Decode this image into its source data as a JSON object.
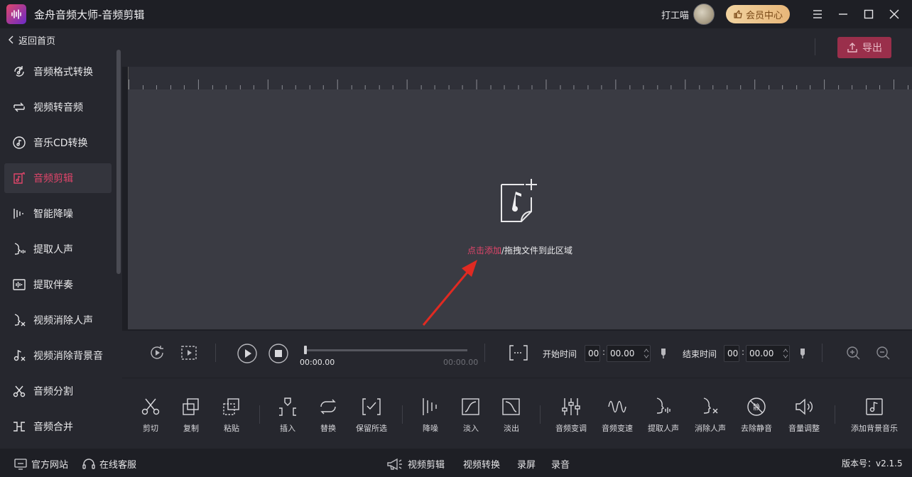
{
  "app": {
    "title": "金舟音频大师-音频剪辑",
    "username": "打工喵",
    "vip_label": "会员中心"
  },
  "sidebar": {
    "back_label": "返回首页",
    "items": [
      {
        "label": "音频格式转换",
        "icon": "audio-convert-icon"
      },
      {
        "label": "视频转音频",
        "icon": "video-to-audio-icon"
      },
      {
        "label": "音乐CD转换",
        "icon": "cd-icon"
      },
      {
        "label": "音频剪辑",
        "icon": "audio-edit-icon",
        "active": true
      },
      {
        "label": "智能降噪",
        "icon": "denoise-icon"
      },
      {
        "label": "提取人声",
        "icon": "extract-voice-icon"
      },
      {
        "label": "提取伴奏",
        "icon": "extract-accompaniment-icon"
      },
      {
        "label": "视频消除人声",
        "icon": "remove-voice-icon"
      },
      {
        "label": "视频消除背景音",
        "icon": "remove-bgm-icon"
      },
      {
        "label": "音频分割",
        "icon": "split-icon"
      },
      {
        "label": "音频合并",
        "icon": "merge-icon"
      }
    ]
  },
  "toolbar": {
    "export_label": "导出"
  },
  "dropzone": {
    "add_link": "点击添加",
    "hint": "/拖拽文件到此区域"
  },
  "transport": {
    "current_time": "00:00.00",
    "total_time": "00:00.00",
    "start_label": "开始时间",
    "end_label": "结束时间",
    "start_min": "00",
    "start_sec": "00.00",
    "end_min": "00",
    "end_sec": "00.00",
    "colon": ":"
  },
  "tools": [
    {
      "label": "剪切",
      "icon": "scissors-icon"
    },
    {
      "label": "复制",
      "icon": "copy-icon"
    },
    {
      "label": "粘贴",
      "icon": "paste-icon"
    },
    {
      "label": "插入",
      "icon": "insert-icon"
    },
    {
      "label": "替换",
      "icon": "replace-icon"
    },
    {
      "label": "保留所选",
      "icon": "keep-selection-icon"
    },
    {
      "label": "降噪",
      "icon": "denoise-icon"
    },
    {
      "label": "淡入",
      "icon": "fade-in-icon"
    },
    {
      "label": "淡出",
      "icon": "fade-out-icon"
    },
    {
      "label": "音频变调",
      "icon": "pitch-icon"
    },
    {
      "label": "音频变速",
      "icon": "speed-icon"
    },
    {
      "label": "提取人声",
      "icon": "extract-voice-icon"
    },
    {
      "label": "消除人声",
      "icon": "remove-voice-icon"
    },
    {
      "label": "去除静音",
      "icon": "remove-silence-icon"
    },
    {
      "label": "音量调整",
      "icon": "volume-icon"
    },
    {
      "label": "添加背景音乐",
      "icon": "add-bgm-icon"
    }
  ],
  "statusbar": {
    "website": "官方网站",
    "support": "在线客服",
    "nav": [
      "视频剪辑",
      "视频转换",
      "录屏",
      "录音"
    ],
    "version": "版本号：v2.1.5"
  },
  "colors": {
    "accent": "#e0456a",
    "export_bg": "#9a2f4b",
    "vip_gold": "#e8b77a"
  }
}
